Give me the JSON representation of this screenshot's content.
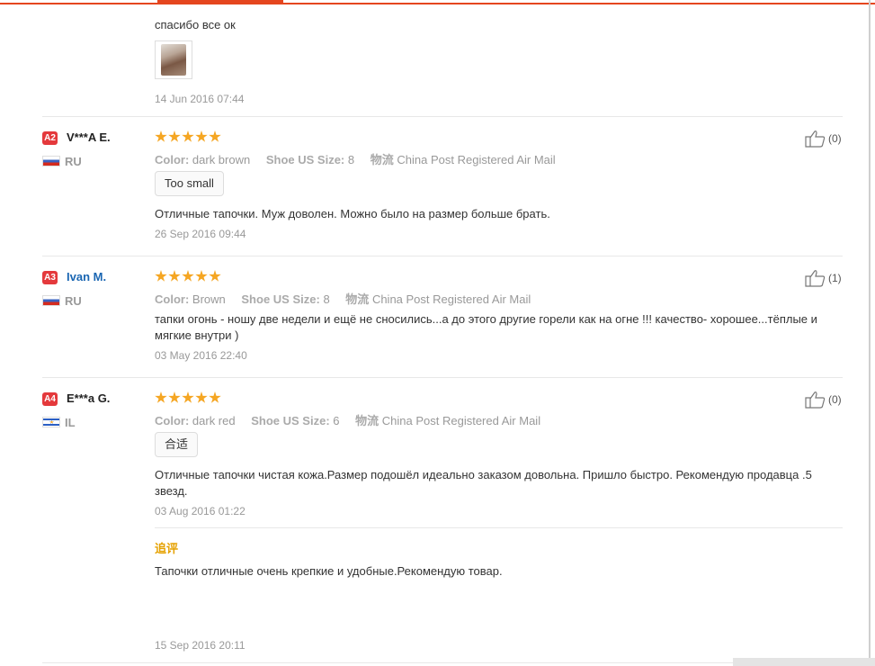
{
  "first_review": {
    "text": "спасибо все ок",
    "photo_icon": "review-photo-thumbnail",
    "date": "14 Jun 2016 07:44"
  },
  "reviews": [
    {
      "badge": "A2",
      "name": "V***A E.",
      "country": "RU",
      "flag": "russia-flag-icon",
      "rating": 5,
      "color_label": "Color:",
      "color_value": "dark brown",
      "size_label": "Shoe US Size:",
      "size_value": "8",
      "shipping_label": "物流",
      "shipping_value": "China Post Registered Air Mail",
      "tag": "Too small",
      "text": "Отличные тапочки. Муж доволен. Можно было на размер больше брать.",
      "date": "26 Sep 2016 09:44",
      "likes": "(0)"
    },
    {
      "badge": "A3",
      "name": "Ivan M.",
      "country": "RU",
      "flag": "russia-flag-icon",
      "rating": 5,
      "color_label": "Color:",
      "color_value": "Brown",
      "size_label": "Shoe US Size:",
      "size_value": "8",
      "shipping_label": "物流",
      "shipping_value": "China Post Registered Air Mail",
      "text_line1": "тапки огонь - ношу две недели и ещё не сносились...а до этого другие горели как на огне !!! качество- хорошее...тёплые и",
      "text_line2": "мягкие внутри )",
      "date": "03 May 2016 22:40",
      "likes": "(1)"
    },
    {
      "badge": "A4",
      "name": "E***a G.",
      "country": "IL",
      "flag": "israel-flag-icon",
      "rating": 5,
      "color_label": "Color:",
      "color_value": "dark red",
      "size_label": "Shoe US Size:",
      "size_value": "6",
      "shipping_label": "物流",
      "shipping_value": "China Post Registered Air Mail",
      "tag": "合适",
      "text_line1": "Отличные тапочки чистая кожа.Размер подошёл идеально заказом довольна. Пришло быстро. Рекомендую продавца .5",
      "text_line2": "звезд.",
      "date": "03 Aug 2016 01:22",
      "likes": "(0)",
      "followup_label": "追评",
      "followup_text": "Тапочки отличные очень крепкие и удобные.Рекомендую товар.",
      "followup_date": "15 Sep 2016 20:11"
    }
  ],
  "colors": {
    "accent": "#e5461f",
    "badge": "#e4393c",
    "star": "#f5a623",
    "followup": "#e5a100",
    "link": "#1a66b2"
  }
}
